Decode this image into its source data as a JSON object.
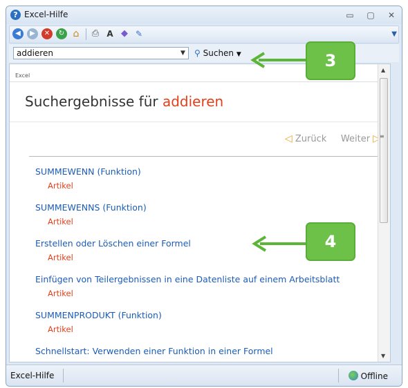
{
  "window": {
    "title": "Excel-Hilfe"
  },
  "toolbar": {
    "icons": [
      "back-icon",
      "forward-icon",
      "stop-icon",
      "refresh-icon",
      "home-icon",
      "print-icon",
      "font-size-icon",
      "keep-on-top-icon",
      "pin-icon"
    ]
  },
  "search": {
    "value": "addieren",
    "button_label": "Suchen"
  },
  "breadcrumb": "Excel",
  "results": {
    "heading_prefix": "Suchergebnisse für",
    "query": "addieren",
    "pager": {
      "back": "Zurück",
      "next": "Weiter"
    },
    "items": [
      {
        "title": "SUMMEWENN (Funktion)",
        "type": "Artikel"
      },
      {
        "title": "SUMMEWENNS (Funktion)",
        "type": "Artikel"
      },
      {
        "title": "Erstellen oder Löschen einer Formel",
        "type": "Artikel"
      },
      {
        "title": "Einfügen von Teilergebnissen in eine Datenliste auf einem Arbeitsblatt",
        "type": "Artikel"
      },
      {
        "title": "SUMMENPRODUKT (Funktion)",
        "type": "Artikel"
      },
      {
        "title": "Schnellstart: Verwenden einer Funktion in einer Formel",
        "type": "Artikel"
      }
    ]
  },
  "statusbar": {
    "left": "Excel-Hilfe",
    "right": "Offline"
  },
  "callouts": [
    {
      "label": "3"
    },
    {
      "label": "4"
    }
  ],
  "colors": {
    "accent": "#e2401b",
    "link": "#1b5cb6",
    "callout": "#6dc048"
  }
}
